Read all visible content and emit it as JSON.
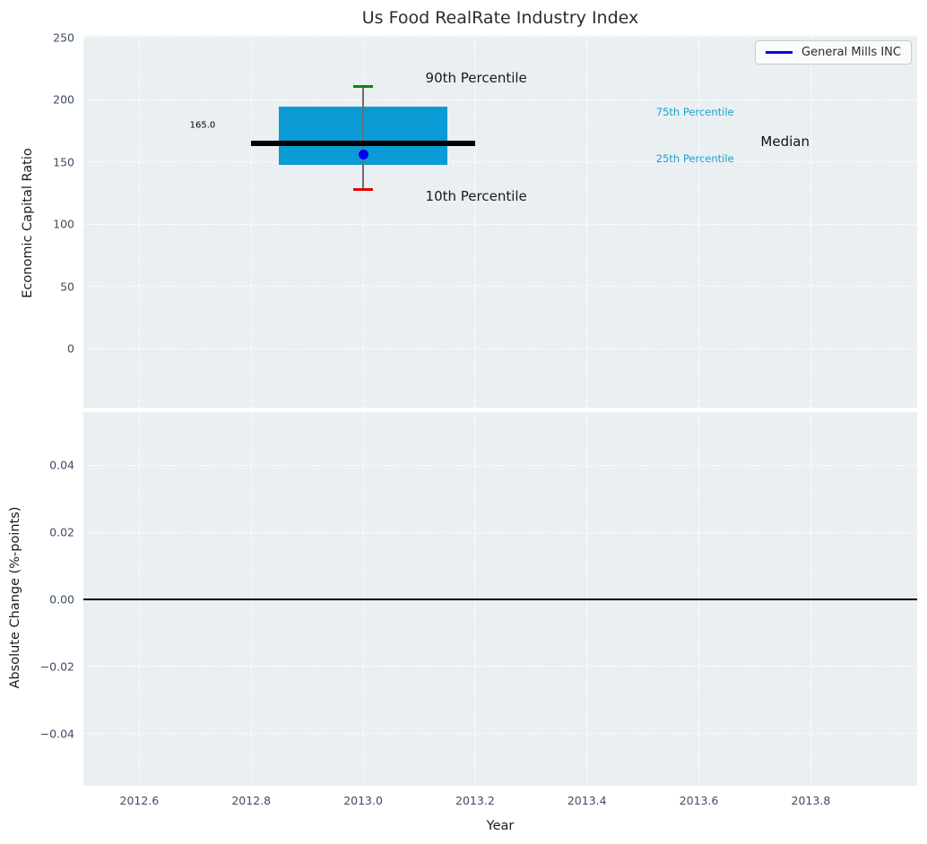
{
  "legend": {
    "label": "General Mills INC",
    "line_color": "#0000ee"
  },
  "colors": {
    "figure_background": "#ffffff",
    "axes_background": "#eaeff1",
    "grid": "#ffffff",
    "box_fill": "#0b9bd4",
    "median_line": "#000000",
    "whisker": "#6e6e6e",
    "cap_90": "#108010",
    "cap_10": "#e60000",
    "company_dot": "#0000ee",
    "percentile_label": "#1c9fd4",
    "tick_label": "#3d4c63",
    "zero_line": "#000000"
  },
  "chart_data": [
    {
      "type": "boxplot",
      "title": "Us Food RealRate Industry Index",
      "ylabel": "Economic Capital Ratio",
      "xlim": [
        2012.5,
        2013.99
      ],
      "ylim": [
        -47.3,
        251.4
      ],
      "show_xtick_labels": false,
      "grid": true,
      "legend_position": "upper right",
      "xticks": [
        {
          "value": 2012.6,
          "label": "2012.6"
        },
        {
          "value": 2012.8,
          "label": "2012.8"
        },
        {
          "value": 2013.0,
          "label": "2013.0"
        },
        {
          "value": 2013.2,
          "label": "2013.2"
        },
        {
          "value": 2013.4,
          "label": "2013.4"
        },
        {
          "value": 2013.6,
          "label": "2013.6"
        },
        {
          "value": 2013.8,
          "label": "2013.8"
        }
      ],
      "yticks": [
        {
          "value": 250,
          "label": "250"
        },
        {
          "value": 200,
          "label": "200"
        },
        {
          "value": 150,
          "label": "150"
        },
        {
          "value": 100,
          "label": "100"
        },
        {
          "value": 50,
          "label": "50"
        },
        {
          "value": 0,
          "label": "0"
        }
      ],
      "box": {
        "x": 2013.0,
        "p90": 210.5,
        "p75": 194.5,
        "median": 165.0,
        "p25": 148.0,
        "p10": 128.0,
        "company": {
          "name": "General Mills INC",
          "value": 156
        },
        "box_halfwidth": 0.15,
        "median_halfwidth": 0.2,
        "cap_halfwidth": 0.017
      },
      "annotations": [
        {
          "name": "median-value-label",
          "text": "165.0",
          "x": 2012.713,
          "y": 179.4,
          "color": "#000000",
          "size": 10
        },
        {
          "name": "p90-label",
          "text": "90th Percentile",
          "x": 2013.202,
          "y": 217.6,
          "color": "#1a1a1a",
          "size": 15
        },
        {
          "name": "p10-label",
          "text": "10th Percentile",
          "x": 2013.202,
          "y": 122.6,
          "color": "#1a1a1a",
          "size": 15
        },
        {
          "name": "p75-label",
          "text": "75th Percentile",
          "x": 2013.593,
          "y": 190.2,
          "color": "#1c9fd4",
          "size": 11.5
        },
        {
          "name": "p25-label",
          "text": "25th Percentile",
          "x": 2013.593,
          "y": 153.0,
          "color": "#1c9fd4",
          "size": 11.5
        },
        {
          "name": "median-label",
          "text": "Median",
          "x": 2013.754,
          "y": 166.7,
          "color": "#111111",
          "size": 15
        }
      ]
    },
    {
      "type": "line",
      "ylabel": "Absolute Change (%-points)",
      "xlabel": "Year",
      "xlim": [
        2012.5,
        2013.99
      ],
      "ylim": [
        -0.0555,
        0.0558
      ],
      "show_xtick_labels": true,
      "grid": true,
      "zero_line": 0.0,
      "series": [],
      "xticks": [
        {
          "value": 2012.6,
          "label": "2012.6"
        },
        {
          "value": 2012.8,
          "label": "2012.8"
        },
        {
          "value": 2013.0,
          "label": "2013.0"
        },
        {
          "value": 2013.2,
          "label": "2013.2"
        },
        {
          "value": 2013.4,
          "label": "2013.4"
        },
        {
          "value": 2013.6,
          "label": "2013.6"
        },
        {
          "value": 2013.8,
          "label": "2013.8"
        }
      ],
      "yticks": [
        {
          "value": 0.04,
          "label": "0.04"
        },
        {
          "value": 0.02,
          "label": "0.02"
        },
        {
          "value": 0.0,
          "label": "0.00"
        },
        {
          "value": -0.02,
          "label": "−0.02"
        },
        {
          "value": -0.04,
          "label": "−0.04"
        }
      ]
    }
  ]
}
